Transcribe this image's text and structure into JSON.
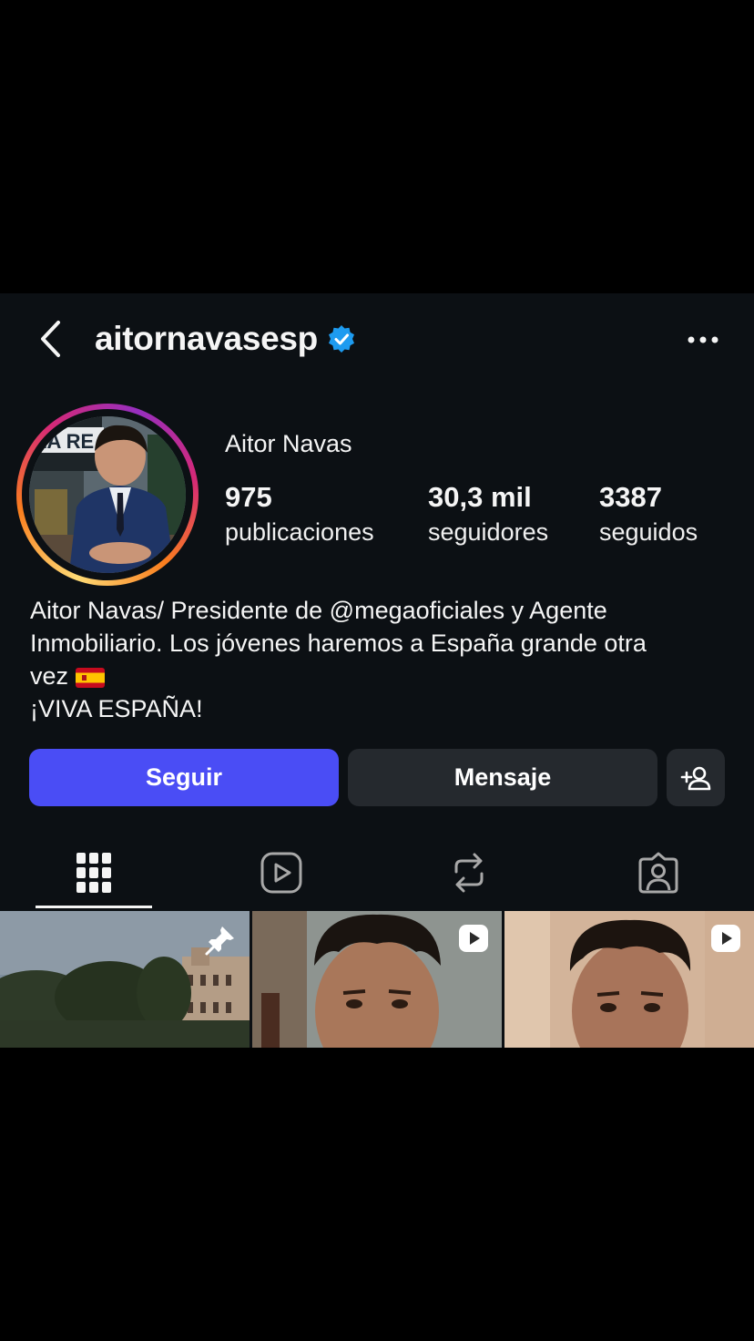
{
  "header": {
    "username": "aitornavasesp",
    "back_icon": "chevron-left-icon",
    "verified_icon": "verified-badge-icon",
    "more_icon": "ellipsis-icon"
  },
  "profile": {
    "name": "Aitor Navas",
    "stats": [
      {
        "value": "975",
        "label": "publicaciones"
      },
      {
        "value": "30,3 mil",
        "label": "seguidores"
      },
      {
        "value": "3387",
        "label": "seguidos"
      }
    ],
    "bio": {
      "line1": "Aitor Navas/ Presidente de @megaoficiales y Agente",
      "line2": "Inmobiliario. Los jóvenes haremos a España grande otra",
      "line3": "vez",
      "line4": "¡VIVA ESPAÑA!"
    }
  },
  "actions": {
    "follow_label": "Seguir",
    "message_label": "Mensaje",
    "add_icon": "add-person-icon"
  },
  "tabs": [
    {
      "icon": "grid-icon",
      "active": true
    },
    {
      "icon": "reels-icon",
      "active": false
    },
    {
      "icon": "reposts-icon",
      "active": false
    },
    {
      "icon": "tagged-icon",
      "active": false
    }
  ],
  "colors": {
    "background": "#0c1014",
    "follow_button": "#4a4df5",
    "secondary_button": "#25292e",
    "verified": "#1d9bf0"
  }
}
